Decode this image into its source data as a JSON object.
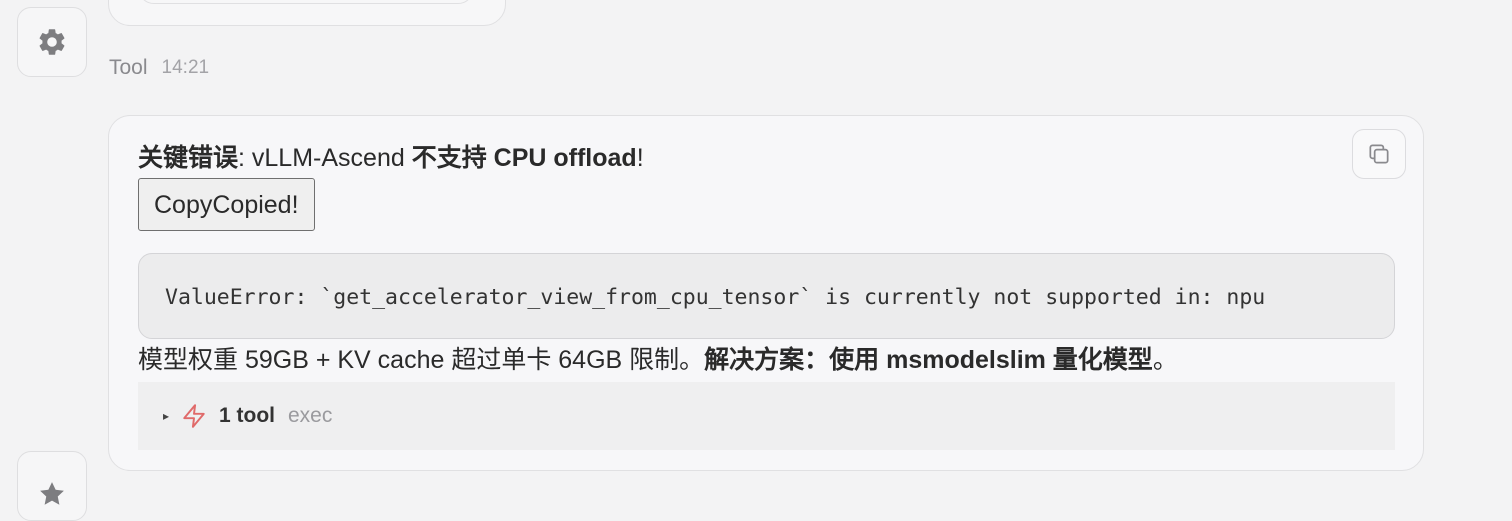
{
  "previous_message": {},
  "message": {
    "sender": "Tool",
    "time": "14:21",
    "headline": {
      "bold_1": "关键错误",
      "text_1": ": vLLM-Ascend ",
      "bold_2": "不支持 CPU offload",
      "text_2": "!"
    },
    "copy_button_label": "CopyCopied!",
    "code": "ValueError: `get_accelerator_view_from_cpu_tensor` is currently not supported in: npu",
    "summary": {
      "text_1": "模型权重 59GB + KV cache 超过单卡 64GB 限制。",
      "bold_1": "解决方案：使用 msmodelslim 量化模型",
      "text_2": "。"
    },
    "tool_section": {
      "caret": "▸",
      "count_label": "1 tool",
      "tool_name": "exec"
    }
  },
  "icons": {
    "settings_avatar": "gear-icon",
    "copy": "copy-icon",
    "tool": "lightning-icon",
    "next_avatar": "star-icon"
  },
  "colors": {
    "background": "#f3f3f4",
    "bubble": "#f7f7f9",
    "code_background": "#ececed",
    "bolt": "#e06a6a"
  }
}
